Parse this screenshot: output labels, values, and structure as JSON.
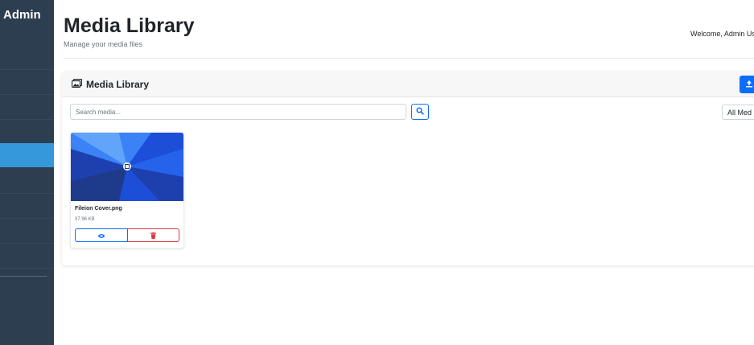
{
  "sidebar": {
    "brand": "Admin"
  },
  "header": {
    "title": "Media Library",
    "subtitle": "Manage your media files",
    "welcome": "Welcome, Admin Us"
  },
  "card": {
    "title": "Media Library",
    "upload_icon": "upload-icon"
  },
  "search": {
    "placeholder": "Search media...",
    "value": "",
    "button_icon": "search-icon"
  },
  "filter": {
    "selected": "All Med"
  },
  "media_items": [
    {
      "name": "Fileion Cover.png",
      "size": "37.96 KB",
      "view_icon": "eye-icon",
      "delete_icon": "trash-icon"
    }
  ],
  "colors": {
    "sidebar_bg": "#2c3e50",
    "sidebar_active": "#3498db",
    "primary": "#0d6efd",
    "danger": "#dc3545"
  }
}
